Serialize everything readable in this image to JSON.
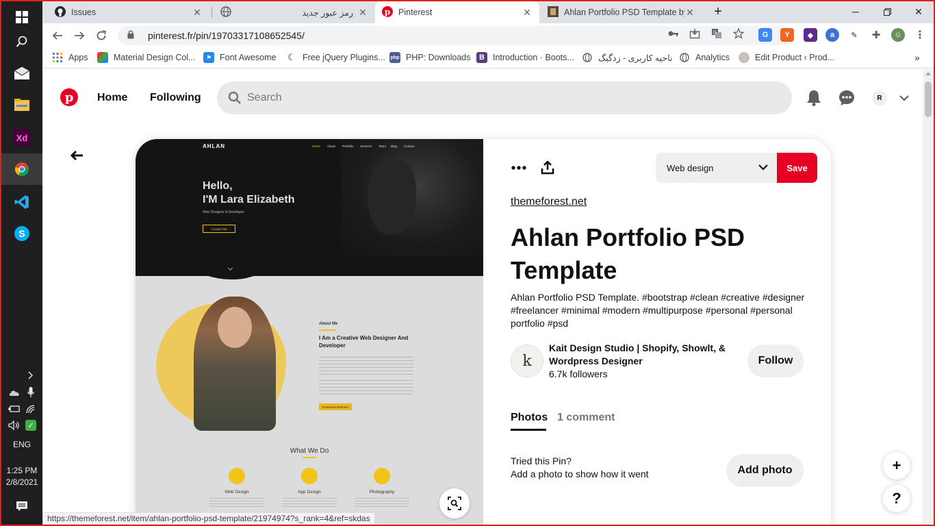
{
  "taskbar": {
    "language": "ENG",
    "time": "1:25 PM",
    "date": "2/8/2021"
  },
  "tabs": [
    {
      "title": "Issues",
      "icon": "github-icon"
    },
    {
      "title": "رمز عبور جدید",
      "icon": "globe-icon"
    },
    {
      "title": "Pinterest",
      "icon": "pinterest-icon",
      "active": true
    },
    {
      "title": "Ahlan Portfolio PSD Template by",
      "icon": "themeforest-icon"
    }
  ],
  "address": {
    "url": "pinterest.fr/pin/19703317108652545/"
  },
  "bookmarks": [
    {
      "label": "Apps"
    },
    {
      "label": "Material Design Col..."
    },
    {
      "label": "Font Awesome"
    },
    {
      "label": "Free jQuery Plugins..."
    },
    {
      "label": "PHP: Downloads"
    },
    {
      "label": "Introduction · Boots..."
    },
    {
      "label": "ناحیه کاربری - زدگیگ"
    },
    {
      "label": "Analytics"
    },
    {
      "label": "Edit Product ‹ Prod..."
    }
  ],
  "pinterest": {
    "nav": {
      "home": "Home",
      "following": "Following"
    },
    "search_placeholder": "Search",
    "avatar_letter": "R"
  },
  "pin": {
    "board": "Web design",
    "save_label": "Save",
    "source": "themeforest.net",
    "title": "Ahlan Portfolio PSD Template",
    "description": "Ahlan Portfolio PSD Template. #bootstrap #clean #creative #designer #freelancer #minimal #modern #multipurpose #personal #personal portfolio #psd",
    "creator": {
      "initial": "k",
      "name": "Kait Design Studio | Shopify, Showlt, & Wordpress Designer",
      "followers": "6.7k followers"
    },
    "follow_label": "Follow",
    "tabs": {
      "photos": "Photos",
      "comments": "1 comment"
    },
    "tried_title": "Tried this Pin?",
    "tried_sub": "Add a photo to show how it went",
    "add_photo_label": "Add photo"
  },
  "mockup": {
    "logo": "AHLAN",
    "nav": [
      "Home",
      "About",
      "Portfolio",
      "Services",
      "Team",
      "Blog",
      "Contact"
    ],
    "hello": "Hello,",
    "name": "I'M Lara Elizabeth",
    "role": "Web Designer & Developer",
    "contact_btn": "Contact Me",
    "about_label": "About Me",
    "about_heading": "I Am a Creative Web Designer And Developer",
    "download_btn": "Download Resume",
    "what_we_do": "What We Do",
    "services": [
      "Web Design",
      "App Design",
      "Photography"
    ]
  },
  "statusbar": {
    "url": "https://themeforest.net/item/ahlan-portfolio-psd-template/21974974?s_rank=4&ref=skdas"
  },
  "colors": {
    "pinterest_red": "#e60023",
    "accent_yellow": "#f0c419",
    "frame_red": "#e0201b"
  }
}
